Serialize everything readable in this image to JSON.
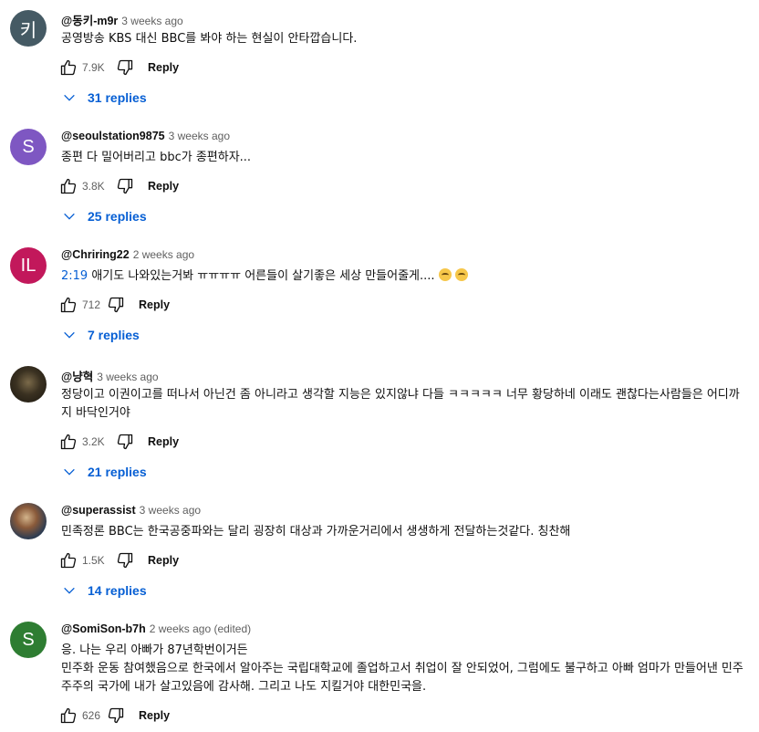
{
  "comments": [
    {
      "author": "@동키-m9r",
      "time": "3 weeks ago",
      "avatar": {
        "letter": "키",
        "color": "#455a64"
      },
      "text": "공영방송 KBS 대신 BBC를 봐야 하는 현실이 안타깝습니다.",
      "likes": "7.9K",
      "reply_label": "Reply",
      "replies_label": "31 replies"
    },
    {
      "author": "@seoulstation9875",
      "time": "3 weeks ago",
      "avatar": {
        "letter": "S",
        "color": "#7e57c2"
      },
      "text": "종편 다 밀어버리고 bbc가 종편하자...",
      "likes": "3.8K",
      "reply_label": "Reply",
      "replies_label": "25 replies"
    },
    {
      "author": "@Chriring22",
      "time": "2 weeks ago",
      "avatar": {
        "letter": "IL",
        "color": "#c2185b"
      },
      "timestamp_link": "2:19",
      "text": " 애기도 나와있는거봐 ㅠㅠㅠㅠ 어른들이 살기좋은 세상 만들어줄게....",
      "emoji": [
        "pleading-face-emoji",
        "pleading-face-emoji"
      ],
      "likes": "712",
      "reply_label": "Reply",
      "replies_label": "7 replies"
    },
    {
      "author": "@냥혁",
      "time": "3 weeks ago",
      "avatar": {
        "letter": "",
        "color": "#3a3121"
      },
      "text": "정당이고 이권이고를 떠나서 아닌건 좀 아니라고 생각할 지능은 있지않냐 다들 ㅋㅋㅋㅋㅋ 너무 황당하네 이래도 괜찮다는사람들은 어디까지 바닥인거야",
      "likes": "3.2K",
      "reply_label": "Reply",
      "replies_label": "21 replies"
    },
    {
      "author": "@superassist",
      "time": "3 weeks ago",
      "avatar": {
        "letter": "",
        "color": "#2f3d52"
      },
      "text": "민족정론 BBC는 한국공중파와는 달리 굉장히 대상과 가까운거리에서 생생하게 전달하는것같다. 칭찬해",
      "likes": "1.5K",
      "reply_label": "Reply",
      "replies_label": "14 replies"
    },
    {
      "author": "@SomiSon-b7h",
      "time": "2 weeks ago (edited)",
      "avatar": {
        "letter": "S",
        "color": "#2e7d32"
      },
      "text": "응. 나는 우리 아빠가 87년학번이거든\n민주화 운동 참여했음으로 한국에서 알아주는 국립대학교에 졸업하고서 취업이 잘 안되었어, 그럼에도 불구하고 아빠 엄마가 만들어낸 민주주주의 국가에 내가 살고있음에 감사해. 그리고 나도 지킬거야 대한민국을.",
      "likes": "626",
      "reply_label": "Reply"
    }
  ]
}
